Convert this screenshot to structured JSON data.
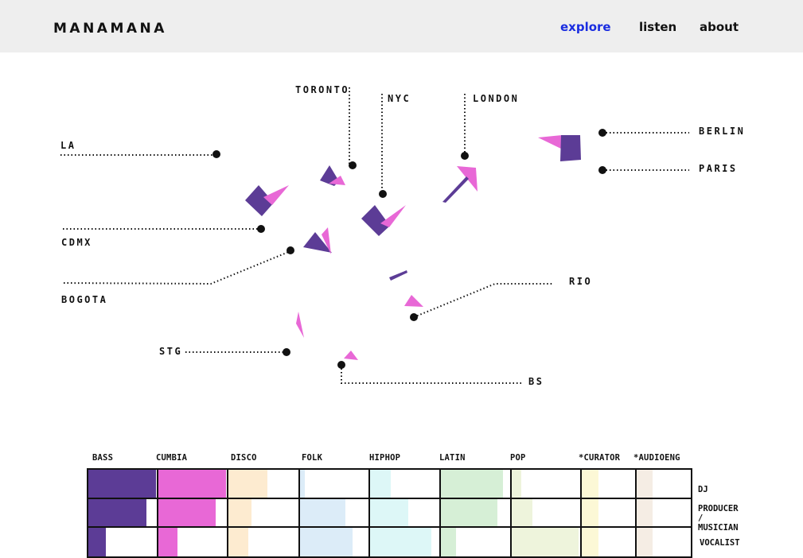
{
  "header": {
    "logo": "MANAMANA",
    "nav": [
      {
        "label": "explore",
        "active": true
      },
      {
        "label": "listen",
        "active": false
      },
      {
        "label": "about",
        "active": false
      }
    ]
  },
  "map": {
    "cities": [
      "TORONTO",
      "NYC",
      "LONDON",
      "BERLIN",
      "PARIS",
      "LA",
      "CDMX",
      "BOGOTA",
      "RIO",
      "STG",
      "BS"
    ],
    "colors": {
      "purple": "#5c3c96",
      "pink": "#e868d6",
      "line": "#111111"
    }
  },
  "matrix": {
    "columns": [
      "BASS",
      "CUMBIA",
      "DISCO",
      "FOLK",
      "HIPHOP",
      "LATIN",
      "POP",
      "*CURATOR",
      "*AUDIOENG"
    ],
    "rows": [
      "DJ",
      "PRODUCER / MUSICIAN",
      "VOCALIST"
    ],
    "column_colors": [
      "#5c3c96",
      "#e868d6",
      "#fdebd0",
      "#dcecf8",
      "#ddf7f7",
      "#d6efd6",
      "#eef4dc",
      "#fcf8d6",
      "#f5ede4"
    ],
    "levels": [
      [
        0.99,
        0.99,
        0.56,
        0.07,
        0.3,
        0.9,
        0.14,
        0.32,
        0.3
      ],
      [
        0.85,
        0.84,
        0.33,
        0.66,
        0.55,
        0.82,
        0.3,
        0.32,
        0.3
      ],
      [
        0.25,
        0.28,
        0.28,
        0.77,
        0.88,
        0.22,
        0.98,
        0.32,
        0.3
      ]
    ]
  }
}
